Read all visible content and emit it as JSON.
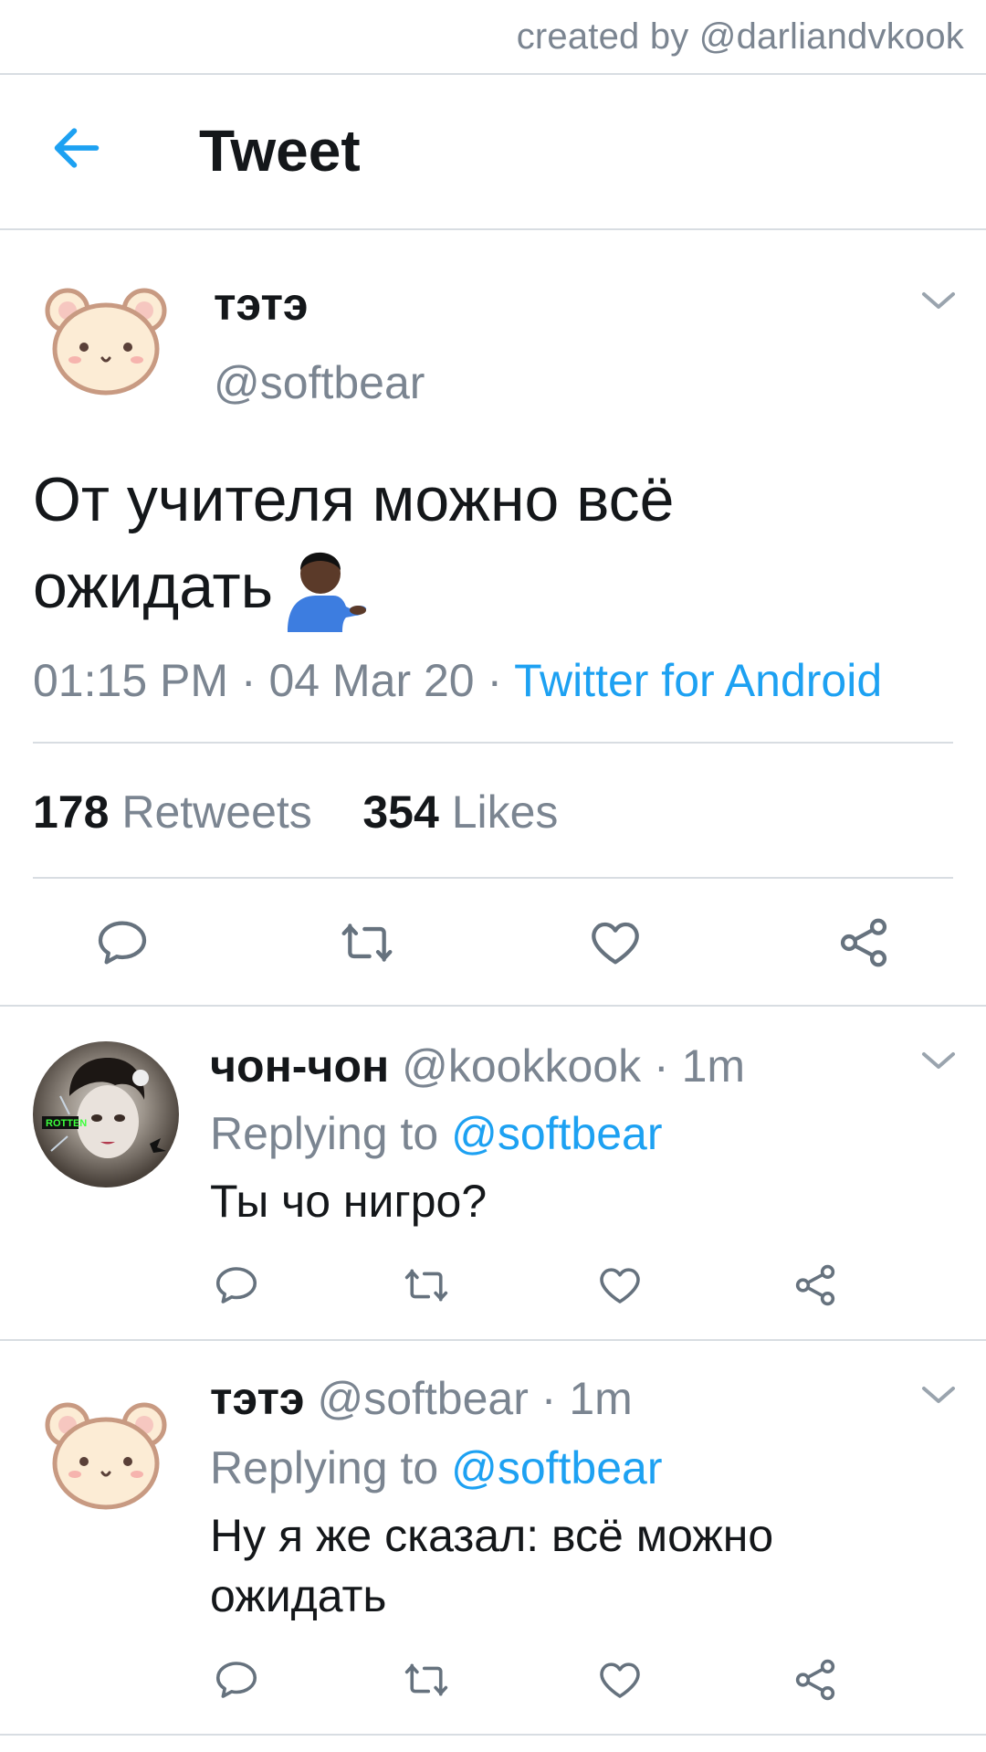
{
  "credit": "created by @darliandvkook",
  "app_bar": {
    "title": "Tweet",
    "back_icon": "arrow-left-icon"
  },
  "tweet": {
    "author_name": "тэтэ",
    "author_handle": "@softbear",
    "text_line1": "От учителя можно всё",
    "text_line2": "ожидать",
    "emoji": "man-tipping-hand-emoji",
    "time": "01:15 PM",
    "date": "04 Mar 20",
    "source": "Twitter for Android",
    "retweets_count": "178",
    "retweets_label": "Retweets",
    "likes_count": "354",
    "likes_label": "Likes"
  },
  "replies": [
    {
      "name": "чон-чон",
      "handle": "@kookkook",
      "time": "1m",
      "replying_label": "Replying to",
      "replying_to": "@softbear",
      "text": "Ты чо нигро?"
    },
    {
      "name": "тэтэ",
      "handle": "@softbear",
      "time": "1m",
      "replying_label": "Replying to",
      "replying_to": "@softbear",
      "text": "Ну я же сказал: всё можно ожидать"
    }
  ],
  "separator": "·",
  "colors": {
    "accent": "#1da1f2",
    "text": "#14171a",
    "muted": "#7b8591",
    "divider": "#d8dde2"
  }
}
